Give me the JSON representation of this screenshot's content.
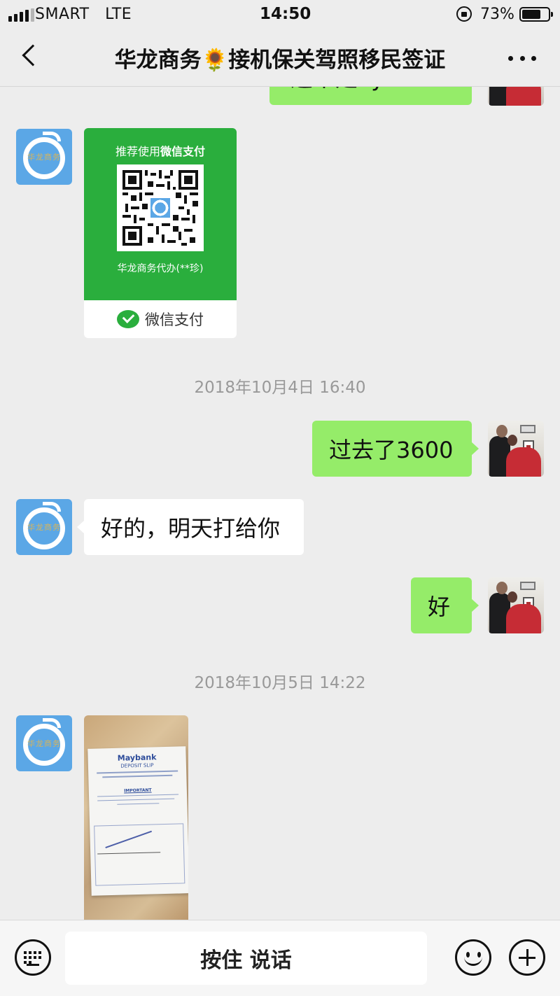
{
  "status_bar": {
    "carrier": "SMART",
    "network": "LTE",
    "time": "14:50",
    "battery_percent": "73%",
    "battery_level": 0.73,
    "signal_bars_active": 4,
    "signal_bars_total": 5
  },
  "nav": {
    "title": "华龙商务🌻接机保关驾照移民签证"
  },
  "avatar_other": {
    "logo_text": "华龙商务"
  },
  "messages": {
    "partial_top": {
      "text": "这不是 ly"
    },
    "qr_card": {
      "recommend_prefix": "推荐使用",
      "recommend_bold": "微信支付",
      "payee": "华龙商务代办(**珍)",
      "footer_label": "微信支付"
    },
    "timestamp_1": "2018年10月4日 16:40",
    "msg_sent_1": "过去了3600",
    "msg_received_1": "好的，明天打给你",
    "msg_sent_2": "好",
    "timestamp_2": "2018年10月5日 14:22",
    "deposit_slip": {
      "bank_name": "Maybank",
      "title": "DEPOSIT SLIP",
      "important": "IMPORTANT"
    }
  },
  "input_bar": {
    "voice_label": "按住 说话"
  },
  "colors": {
    "bubble_sent": "#95ec69",
    "bubble_received": "#ffffff",
    "wechat_green": "#2aae3d",
    "background": "#ededed"
  }
}
